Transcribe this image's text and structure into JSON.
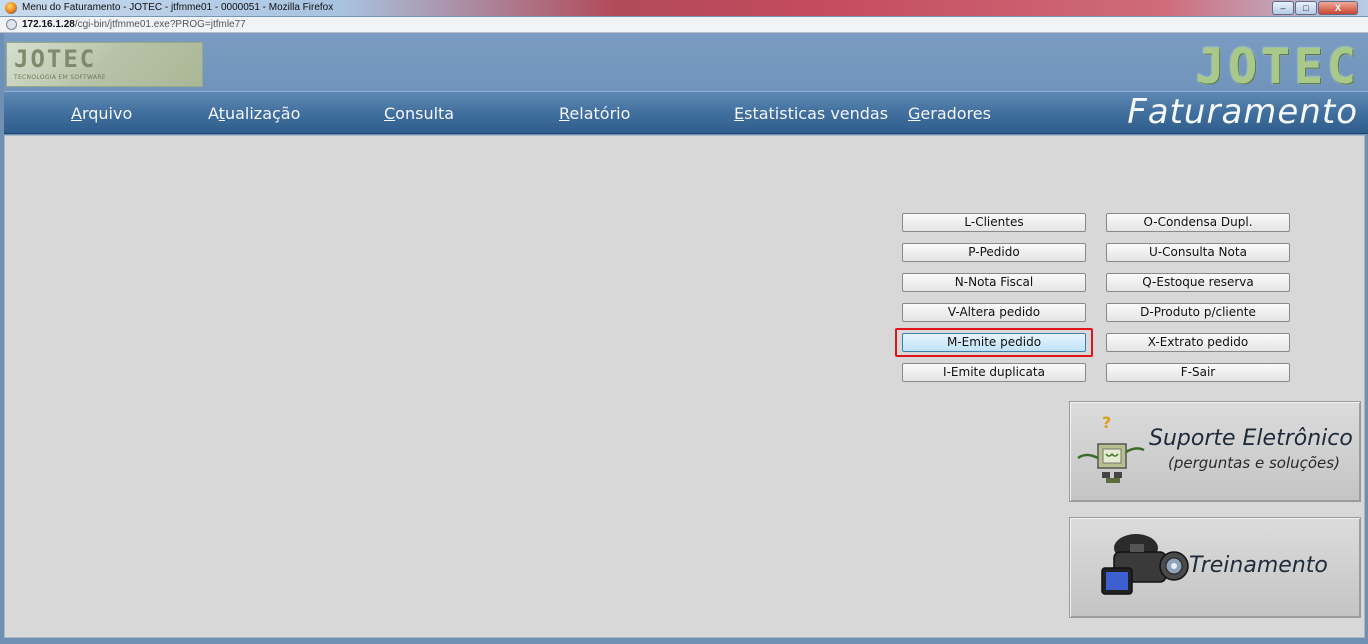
{
  "window": {
    "title": "Menu do Faturamento - JOTEC - jtfmme01 - 0000051 - Mozilla Firefox",
    "url_host": "172.16.1.28",
    "url_path": "/cgi-bin/jtfmme01.exe?PROG=jtfmle77",
    "buttons": {
      "minimize": "–",
      "maximize": "□",
      "close": "X"
    }
  },
  "header": {
    "logo_small": "JOTEC",
    "logo_tagline": "TECNOLOGIA EM SOFTWARE",
    "logo_big": "JOTEC"
  },
  "menu": {
    "items": [
      {
        "acc": "A",
        "rest": "rquivo"
      },
      {
        "pre": "A",
        "acc": "t",
        "rest": "ualização"
      },
      {
        "acc": "C",
        "rest": "onsulta"
      },
      {
        "acc": "R",
        "rest": "elatório"
      },
      {
        "acc": "E",
        "rest": "statisticas vendas"
      },
      {
        "acc": "G",
        "rest": "eradores"
      }
    ],
    "module_title": "Faturamento"
  },
  "actions": {
    "left": [
      "L-Clientes",
      "P-Pedido",
      "N-Nota Fiscal",
      "V-Altera pedido",
      "M-Emite pedido",
      "I-Emite duplicata"
    ],
    "right": [
      "O-Condensa Dupl.",
      "U-Consulta Nota",
      "Q-Estoque reserva",
      "D-Produto p/cliente",
      "X-Extrato pedido",
      "F-Sair"
    ],
    "highlighted": "M-Emite pedido"
  },
  "support": {
    "title": "Suporte Eletrônico",
    "subtitle": "(perguntas e soluções)"
  },
  "training": {
    "title": "Treinamento"
  },
  "icons": [
    "firefox-icon",
    "site-identity-icon",
    "robot-icon",
    "video-camera-icon"
  ]
}
